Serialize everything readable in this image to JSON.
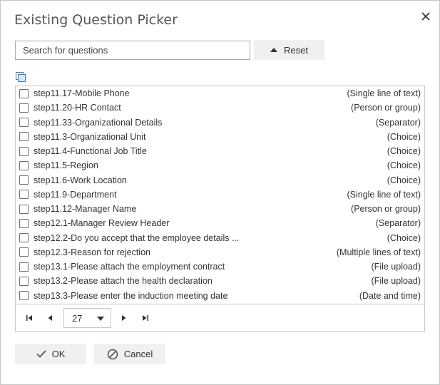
{
  "dialog": {
    "title": "Existing Question Picker"
  },
  "search": {
    "placeholder": "Search for questions",
    "reset_label": "Reset"
  },
  "questions": [
    {
      "label": "step11.17-Mobile Phone",
      "type": "(Single line of text)"
    },
    {
      "label": "step11.20-HR Contact",
      "type": "(Person or group)"
    },
    {
      "label": "step11.33-Organizational Details",
      "type": "(Separator)"
    },
    {
      "label": "step11.3-Organizational Unit",
      "type": "(Choice)"
    },
    {
      "label": "step11.4-Functional Job Title",
      "type": "(Choice)"
    },
    {
      "label": "step11.5-Region",
      "type": "(Choice)"
    },
    {
      "label": "step11.6-Work Location",
      "type": "(Choice)"
    },
    {
      "label": "step11.9-Department",
      "type": "(Single line of text)"
    },
    {
      "label": "step11.12-Manager Name",
      "type": "(Person or group)"
    },
    {
      "label": "step12.1-Manager Review Header",
      "type": "(Separator)"
    },
    {
      "label": "step12.2-Do you accept that the employee details ...",
      "type": "(Choice)"
    },
    {
      "label": "step12.3-Reason for rejection",
      "type": "(Multiple lines of text)"
    },
    {
      "label": "step13.1-Please attach the employment contract",
      "type": "(File upload)"
    },
    {
      "label": "step13.2-Please attach the health declaration",
      "type": "(File upload)"
    },
    {
      "label": "step13.3-Please enter the induction meeting date",
      "type": "(Date and time)"
    }
  ],
  "pager": {
    "current_page": "27"
  },
  "footer": {
    "ok_label": "OK",
    "cancel_label": "Cancel"
  },
  "colors": {
    "border": "#c6c6c6",
    "button_bg": "#f0f0f0",
    "text": "#333333",
    "icon_blue": "#3c78c8"
  },
  "icons": {
    "close": "close-icon",
    "reset": "caret-up-icon",
    "select_all": "copy-stack-icon",
    "first": "first-page-icon",
    "prev": "prev-page-icon",
    "next": "next-page-icon",
    "last": "last-page-icon",
    "dropdown": "chevron-down-icon",
    "ok": "check-icon",
    "cancel": "cancel-circle-icon"
  }
}
